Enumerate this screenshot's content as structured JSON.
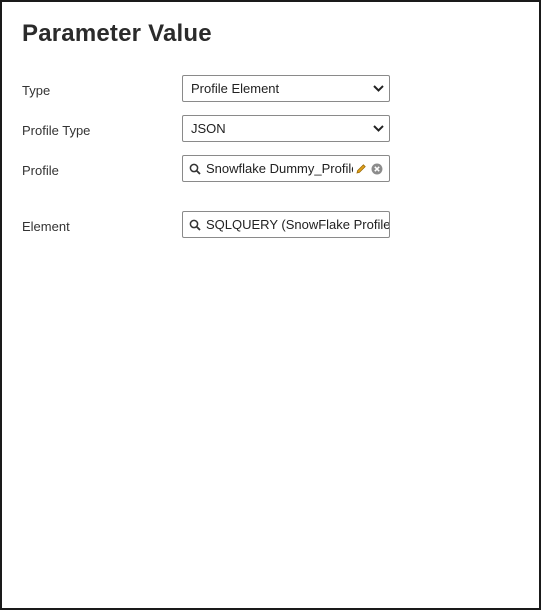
{
  "dialog": {
    "title": "Parameter Value"
  },
  "fields": {
    "type": {
      "label": "Type",
      "value": "Profile Element"
    },
    "profile_type": {
      "label": "Profile Type",
      "value": "JSON"
    },
    "profile": {
      "label": "Profile",
      "value": "Snowflake Dummy_Profile"
    },
    "element": {
      "label": "Element",
      "value": "SQLQUERY (SnowFlake Profile)"
    }
  },
  "icons": {
    "dropdown": "chevron-down-icon",
    "search": "search-icon",
    "edit": "pencil-icon",
    "clear": "clear-icon"
  },
  "colors": {
    "border": "#8a8a8a",
    "frame": "#1a1a1a",
    "edit_icon": "#e3a21a",
    "clear_icon": "#8c8c8c"
  }
}
